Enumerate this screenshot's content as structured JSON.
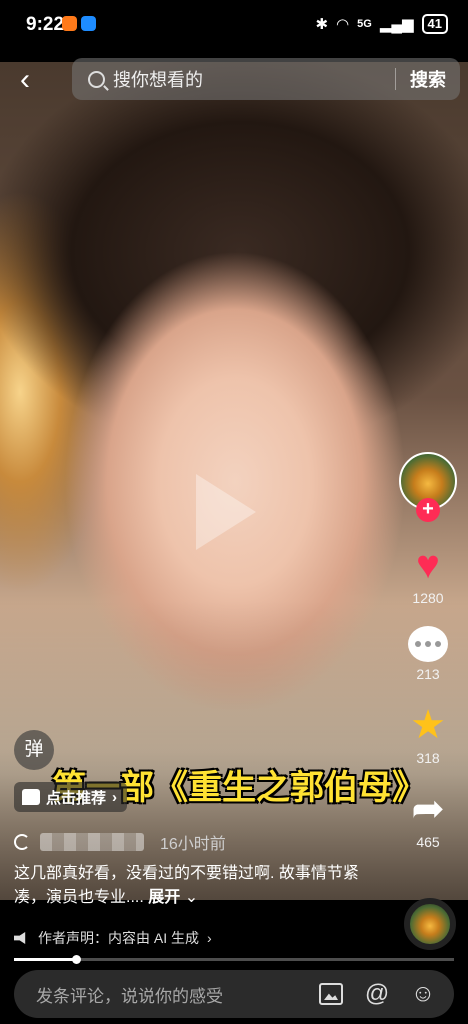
{
  "status_bar": {
    "time": "9:22",
    "network": "5G",
    "battery": "41"
  },
  "search": {
    "placeholder": "搜你想看的",
    "button": "搜索"
  },
  "actions": {
    "follow": "+",
    "likes": "1280",
    "comments": "213",
    "favorites": "318",
    "shares": "465"
  },
  "overlay": {
    "danmu": "弹",
    "promo": "点击推荐",
    "title": "第一部《重生之郭伯母》"
  },
  "post": {
    "time": "16小时前",
    "description": "这几部真好看，没看过的不要错过啊. 故事情节紧凑，演员也专业....",
    "expand": "展开",
    "ai_notice": "作者声明：内容由 AI 生成"
  },
  "progress": {
    "fraction": 0.14
  },
  "comment_bar": {
    "placeholder": "发条评论，说说你的感受"
  },
  "colors": {
    "accent": "#fe2c55",
    "favorite": "#ffc21a",
    "title_text": "#ffe233"
  }
}
